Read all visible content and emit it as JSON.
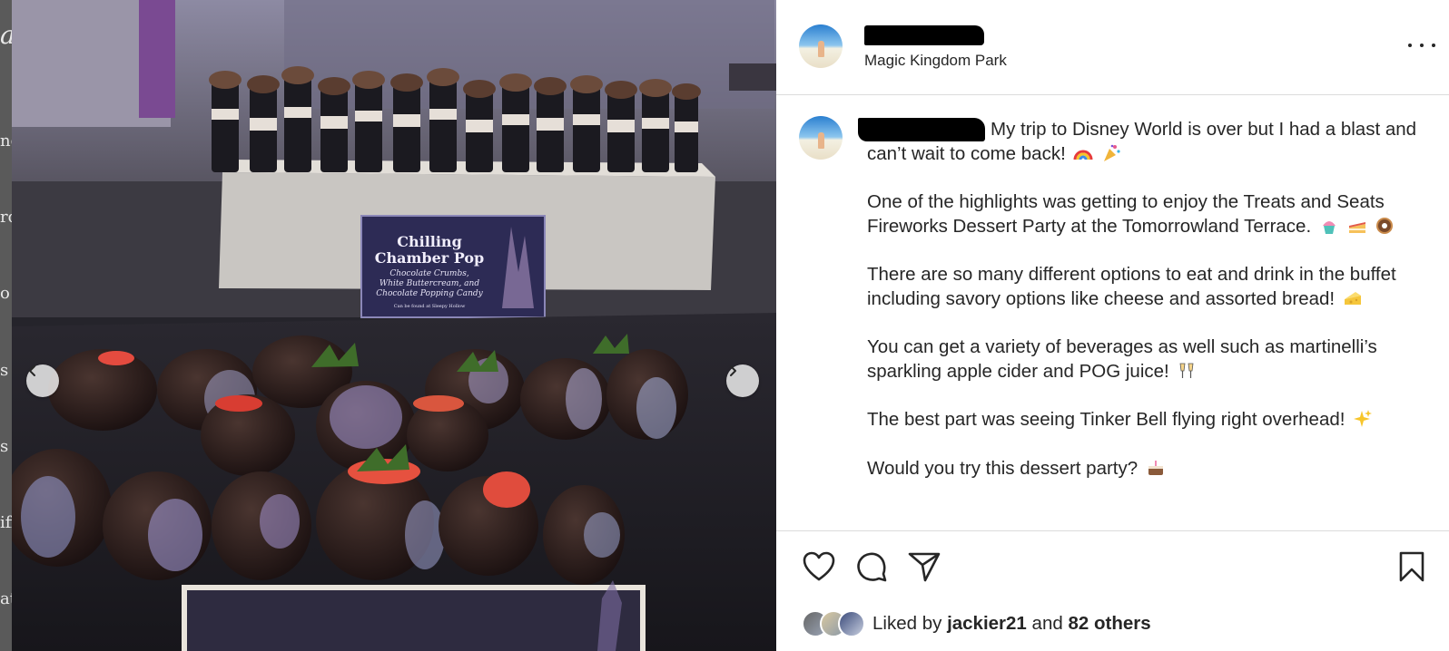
{
  "left_edge": {
    "fragments": [
      "a",
      "ne",
      "ro",
      "o",
      "s",
      "s",
      "iff",
      "at"
    ]
  },
  "media": {
    "sign_title_line1": "Chilling",
    "sign_title_line2": "Chamber Pop",
    "sign_desc_line1": "Chocolate Crumbs,",
    "sign_desc_line2": "White Buttercream, and",
    "sign_desc_line3": "Chocolate Popping Candy",
    "sign_note": "Can be found at Sleepy Hollow",
    "prev_icon": "chevron-left-icon",
    "next_icon": "chevron-right-icon"
  },
  "post": {
    "location": "Magic Kingdom Park",
    "more_icon": "more-horizontal-icon",
    "caption": {
      "line1": "My trip to Disney World is over but I had a blast and can’t wait to come back!",
      "para2": "One of the highlights was getting to enjoy the Treats and Seats Fireworks Dessert Party at the Tomorrowland Terrace.",
      "para3": "There are so many different options to eat and drink in the buffet including savory options like cheese and assorted bread!",
      "para4": "You can get a variety of beverages as well such as martinelli’s sparkling apple cider and POG juice!",
      "para5": "The best part was seeing Tinker Bell flying right overhead!",
      "para6": "Would you try this dessert party?"
    },
    "emoji": [
      "rainbow-emoji",
      "party-popper-emoji",
      "cupcake-emoji",
      "cake-slice-emoji",
      "donut-emoji",
      "cheese-emoji",
      "clinking-glasses-emoji",
      "sparkles-emoji",
      "cake-emoji"
    ],
    "actions": {
      "like_icon": "heart-icon",
      "comment_icon": "comment-icon",
      "share_icon": "share-icon",
      "save_icon": "bookmark-icon"
    },
    "likes": {
      "prefix": "Liked by",
      "user": "jackier21",
      "and": "and",
      "others": "82 others"
    }
  }
}
